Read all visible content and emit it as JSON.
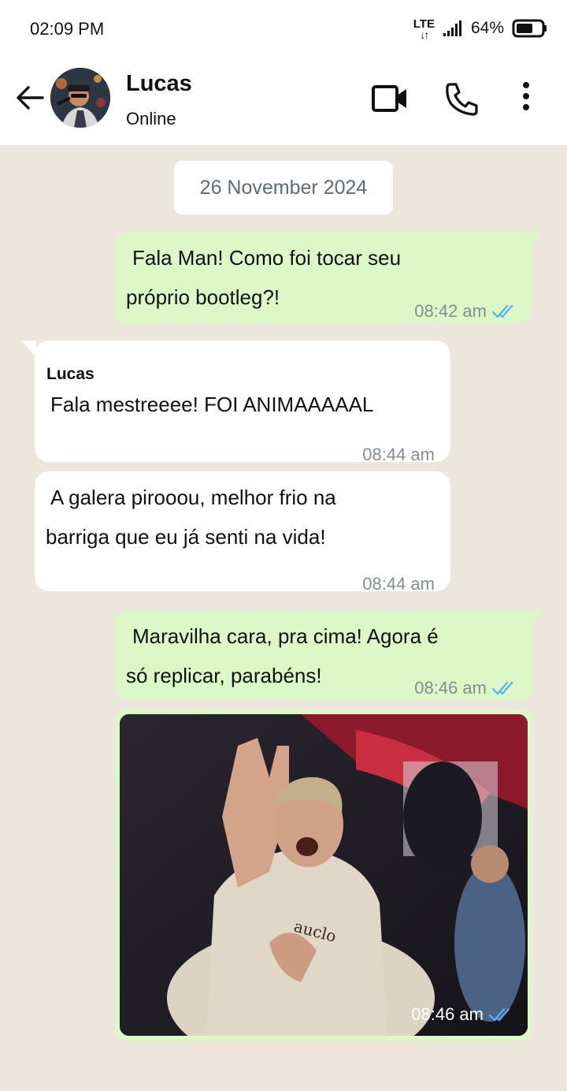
{
  "status_bar": {
    "time": "02:09 PM",
    "network": "LTE",
    "battery": "64%"
  },
  "header": {
    "contact_name": "Lucas",
    "contact_status": "Online",
    "icons": [
      "back-arrow-icon",
      "video-call-icon",
      "phone-icon",
      "more-options-icon"
    ]
  },
  "chat": {
    "date_separator": "26 November 2024",
    "messages": [
      {
        "direction": "outgoing",
        "lines": [
          "Fala Man! Como foi tocar seu",
          "próprio bootleg?!"
        ],
        "time": "08:42 am",
        "status": "read"
      },
      {
        "direction": "incoming",
        "sender": "Lucas",
        "lines": [
          "Fala mestreeee! FOI ANIMAAAAAL"
        ],
        "time": "08:44 am"
      },
      {
        "direction": "incoming",
        "lines": [
          "A galera pirooou, melhor frio na",
          "barriga que eu já senti na vida!"
        ],
        "time": "08:44 am"
      },
      {
        "direction": "outgoing",
        "lines": [
          "Maravilha cara, pra cima!  Agora é",
          "só replicar, parabéns!"
        ],
        "time": "08:46 am",
        "status": "read"
      },
      {
        "direction": "outgoing",
        "type": "image",
        "time": "08:46 am",
        "status": "read"
      }
    ]
  },
  "colors": {
    "outgoing_bubble": "#dcf8c6",
    "incoming_bubble": "#ffffff",
    "chat_background": "#ece6dd",
    "read_ticks": "#4fb3f6"
  }
}
